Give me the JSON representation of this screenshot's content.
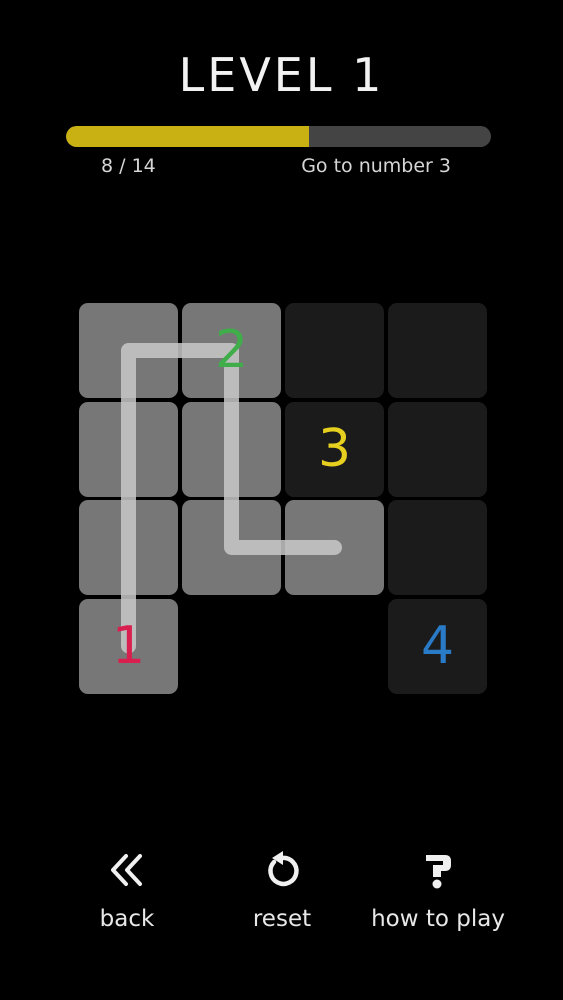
{
  "header": {
    "title": "LEVEL 1"
  },
  "progress": {
    "current": 8,
    "total": 14,
    "label": "8 / 14",
    "hint": "Go to number 3",
    "fill_color": "#c9b114",
    "track_color": "#444444"
  },
  "board": {
    "rows": 4,
    "cols": 4,
    "cells": [
      {
        "row": 0,
        "col": 0,
        "state": "filled"
      },
      {
        "row": 0,
        "col": 1,
        "state": "filled",
        "number": "2",
        "color": "#3fae4a"
      },
      {
        "row": 0,
        "col": 2,
        "state": "empty"
      },
      {
        "row": 0,
        "col": 3,
        "state": "empty"
      },
      {
        "row": 1,
        "col": 0,
        "state": "filled"
      },
      {
        "row": 1,
        "col": 1,
        "state": "filled"
      },
      {
        "row": 1,
        "col": 2,
        "state": "empty",
        "number": "3",
        "color": "#e6cf1e"
      },
      {
        "row": 1,
        "col": 3,
        "state": "empty"
      },
      {
        "row": 2,
        "col": 0,
        "state": "filled"
      },
      {
        "row": 2,
        "col": 1,
        "state": "filled"
      },
      {
        "row": 2,
        "col": 2,
        "state": "filled"
      },
      {
        "row": 2,
        "col": 3,
        "state": "empty"
      },
      {
        "row": 3,
        "col": 0,
        "state": "filled",
        "number": "1",
        "color": "#d81f4f"
      },
      {
        "row": 3,
        "col": 3,
        "state": "empty",
        "number": "4",
        "color": "#2a7bc7"
      }
    ],
    "path": [
      [
        3,
        0
      ],
      [
        2,
        0
      ],
      [
        1,
        0
      ],
      [
        0,
        0
      ],
      [
        0,
        1
      ],
      [
        1,
        1
      ],
      [
        2,
        1
      ],
      [
        2,
        2
      ]
    ],
    "path_color": "#c8c8c8"
  },
  "controls": {
    "back_label": "back",
    "reset_label": "reset",
    "help_label": "how to play",
    "back_icon": "double-chevron-left-icon",
    "reset_icon": "reset-arrow-icon",
    "help_icon": "question-mark-icon"
  }
}
